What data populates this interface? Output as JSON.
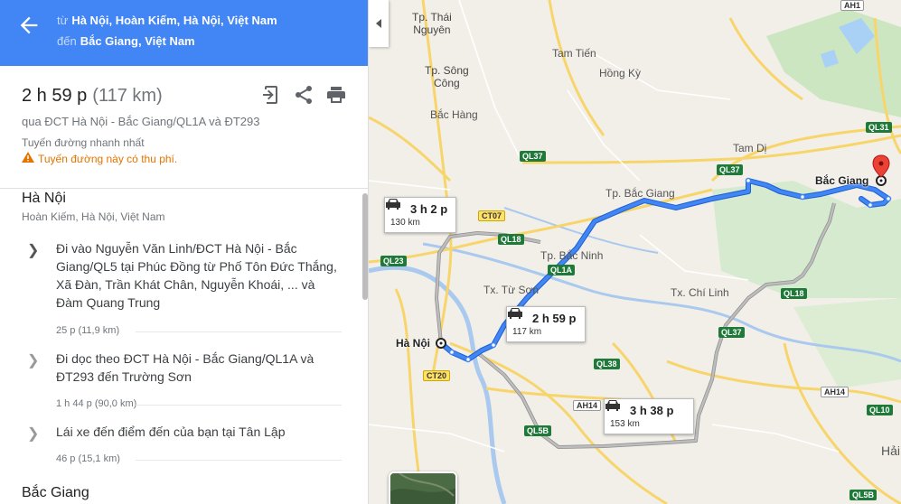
{
  "header": {
    "from_prefix": "từ",
    "from": "Hà Nội, Hoàn Kiếm, Hà Nội, Việt Nam",
    "to_prefix": "đến",
    "to": "Bắc Giang, Việt Nam",
    "accent_color": "#4285f4"
  },
  "summary": {
    "time": "2 h 59 p",
    "distance": "(117 km)",
    "via": "qua ĐCT Hà Nội - Bắc Giang/QL1A và ĐT293",
    "fastest": "Tuyến đường nhanh nhất",
    "toll_warning": "Tuyến đường này có thu phí.",
    "actions": [
      "send-to-device-icon",
      "share-icon",
      "print-icon"
    ]
  },
  "origin": {
    "title": "Hà Nội",
    "subtitle": "Hoàn Kiếm, Hà Nội, Việt Nam"
  },
  "steps": [
    {
      "text": "Đi vào Nguyễn Văn Linh/ĐCT Hà Nội - Bắc Giang/QL5 tại Phúc Đồng từ Phố Tôn Đức Thắng, Xã Đàn, Trần Khát Chân, Nguyễn Khoái, ... và Đàm Quang Trung",
      "meta": "25 p (11,9 km)"
    },
    {
      "text": "Đi dọc theo ĐCT Hà Nội - Bắc Giang/QL1A và ĐT293 đến Trường Sơn",
      "meta": "1 h 44 p (90,0 km)"
    },
    {
      "text": "Lái xe đến điểm đến của bạn tại Tân Lập",
      "meta": "46 p (15,1 km)"
    }
  ],
  "destination": {
    "title": "Bắc Giang"
  },
  "map": {
    "places": {
      "thai_nguyen": "Tp. Thái\nNguyên",
      "tam_tien": "Tam Tiến",
      "hong_ky": "Hồng Kỳ",
      "song_cong": "Tp. Sông\nCông",
      "bac_hang": "Bắc Hàng",
      "tam_di": "Tam Dị",
      "tp_bac_giang": "Tp. Bắc Giang",
      "tp_bac_ninh": "Tp. Bắc Ninh",
      "tu_son": "Tx. Từ Sơn",
      "chi_linh": "Tx. Chí Linh",
      "hai": "Hải"
    },
    "hanoi_label": "Hà Nội",
    "bacgiang_label": "Bắc Giang",
    "shields": {
      "ah1": "AH1",
      "ql31": "QL31",
      "ql37a": "QL37",
      "ql37b": "QL37",
      "ql37c": "QL37",
      "ct07": "CT07",
      "ql18a": "QL18",
      "ql18b": "QL18",
      "ql23": "QL23",
      "ql1a": "QL1A",
      "ql38": "QL38",
      "ct20": "CT20",
      "ah14a": "AH14",
      "ah14b": "AH14",
      "ql5b": "QL5B",
      "ql10": "QL10",
      "ql5b2": "QL5B"
    },
    "routes": [
      {
        "time": "3 h 2 p",
        "distance": "130 km"
      },
      {
        "time": "2 h 59 p",
        "distance": "117 km"
      },
      {
        "time": "3 h 38 p",
        "distance": "153 km"
      }
    ],
    "route_color": "#4285f4",
    "alt_route_color": "#9e9e9e",
    "destination_pin_color": "#ea4335"
  }
}
